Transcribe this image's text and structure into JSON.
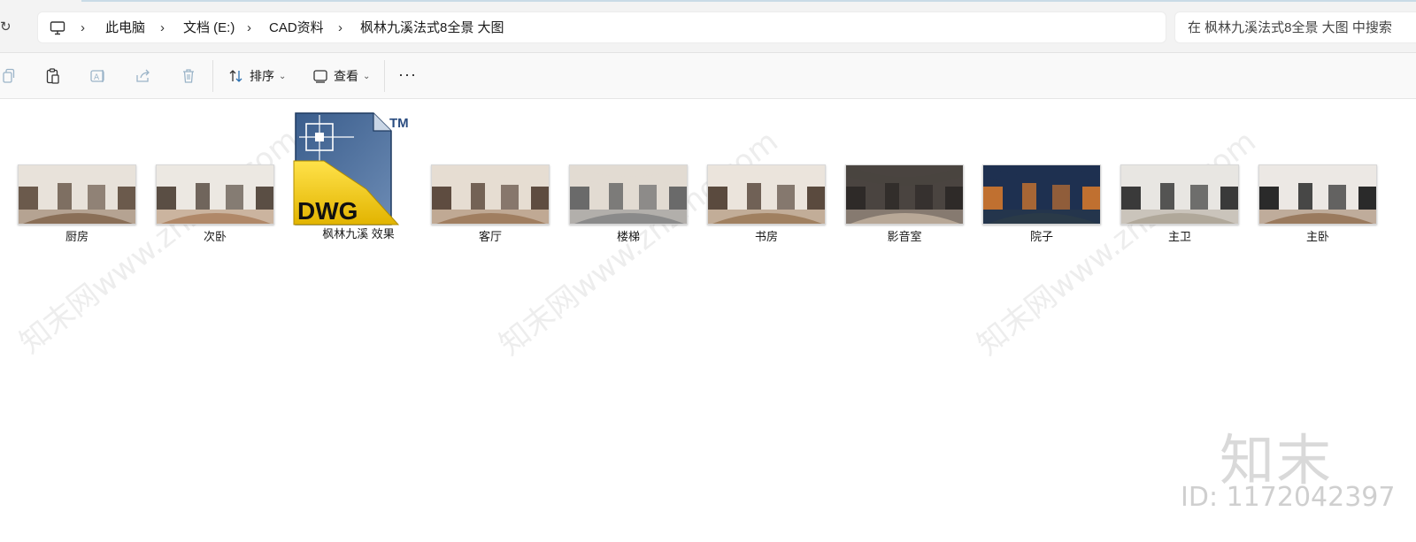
{
  "address": {
    "crumbs": [
      "此电脑",
      "文档 (E:)",
      "CAD资料",
      "枫林九溪法式8全景 大图"
    ],
    "search_placeholder": "在 枫林九溪法式8全景 大图 中搜索"
  },
  "toolbar": {
    "sort_label": "排序",
    "view_label": "查看",
    "more_label": "···"
  },
  "files": [
    {
      "name": "厨房",
      "colors": [
        "#e8e2da",
        "#6b5a4c",
        "#8a7058"
      ]
    },
    {
      "name": "次卧",
      "colors": [
        "#ece8e2",
        "#5a4e44",
        "#b08868"
      ]
    },
    {
      "name": "枫林九溪 效果",
      "icon": "dwg-file-icon"
    },
    {
      "name": "客厅",
      "colors": [
        "#e6ddd2",
        "#5e4c40",
        "#a07e60"
      ]
    },
    {
      "name": "楼梯",
      "colors": [
        "#e2dbd2",
        "#6a6a6a",
        "#8a8a8a"
      ]
    },
    {
      "name": "书房",
      "colors": [
        "#ebe4dc",
        "#5a4a3e",
        "#a08060"
      ]
    },
    {
      "name": "影音室",
      "colors": [
        "#4a4440",
        "#2e2a28",
        "#b8a898"
      ]
    },
    {
      "name": "院子",
      "colors": [
        "#1e3050",
        "#c07030",
        "#2a3a48"
      ]
    },
    {
      "name": "主卫",
      "colors": [
        "#e8e6e2",
        "#3a3a3a",
        "#b0a89a"
      ]
    },
    {
      "name": "主卧",
      "colors": [
        "#ece8e4",
        "#2a2a2a",
        "#9a7a5e"
      ]
    }
  ],
  "dwg_icon": {
    "text": "DWG",
    "tm": "TM"
  },
  "watermark": {
    "logo": "知末",
    "id": "ID: 1172042397",
    "diagonal": "知末网www.znzmo.com"
  }
}
